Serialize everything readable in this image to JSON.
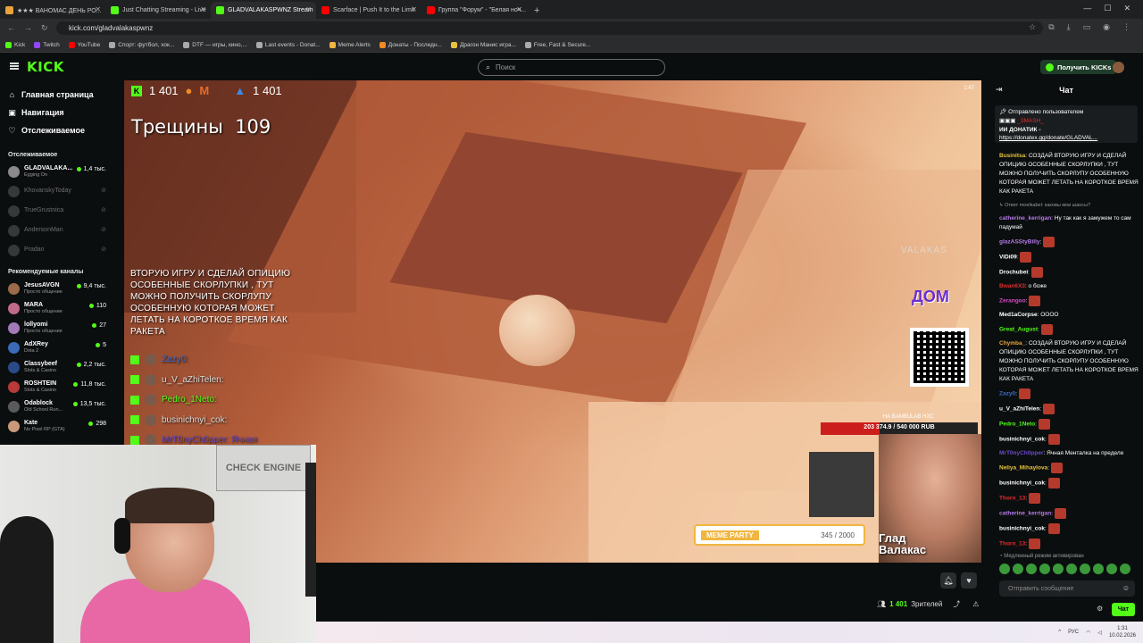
{
  "browser": {
    "tabs": [
      {
        "title": "★★★ ВАНОМАС ДЕНЬ РО...",
        "color": "#e8a33c"
      },
      {
        "title": "Just Chatting Streaming - Live",
        "color": "#53fc18"
      },
      {
        "title": "GLADVALAKASPWNZ Stream",
        "color": "#53fc18",
        "active": true
      },
      {
        "title": "Scarface | Push It to the Limit",
        "color": "#ff0000"
      },
      {
        "title": "Группа \"Форум\" - \"Белая ноч...",
        "color": "#ff0000"
      }
    ],
    "url": "kick.com/gladvalakaspwnz",
    "bookmarks": [
      {
        "label": "Kick",
        "color": "#53fc18"
      },
      {
        "label": "Twitch",
        "color": "#9146ff"
      },
      {
        "label": "YouTube",
        "color": "#ff0000"
      },
      {
        "label": "Спорт: футбол, хок...",
        "color": "#aaaaaa"
      },
      {
        "label": "DTF — игры, кино,...",
        "color": "#aaaaaa"
      },
      {
        "label": "Last events - Donat...",
        "color": "#aaaaaa"
      },
      {
        "label": "Meme Alerts",
        "color": "#f0b640"
      },
      {
        "label": "Донаты - Последн...",
        "color": "#f08a24"
      },
      {
        "label": "Драгон Манис игра...",
        "color": "#e8c33c"
      },
      {
        "label": "Free, Fast & Secure...",
        "color": "#aaaaaa"
      }
    ]
  },
  "header": {
    "logo": "KICK",
    "search_placeholder": "Поиск",
    "get_kicks": "Получить KICKs"
  },
  "sidebar": {
    "nav": [
      {
        "label": "Главная страница",
        "icon": "home-icon",
        "glyph": "⌂"
      },
      {
        "label": "Навигация",
        "icon": "browse-icon",
        "glyph": "▣"
      },
      {
        "label": "Отслеживаемое",
        "icon": "heart-icon",
        "glyph": "♡"
      }
    ],
    "followed_title": "Отслеживаемое",
    "followed": [
      {
        "name": "GLADVALAKA...",
        "sub": "Egging On",
        "viewers": "1,4 тыс.",
        "live": true,
        "color": "#8a8a8a"
      },
      {
        "name": "KhovanskyToday",
        "live": false,
        "color": "#777777"
      },
      {
        "name": "TrueGrustnica",
        "live": false,
        "color": "#777777"
      },
      {
        "name": "AndersonMan",
        "live": false,
        "color": "#777777"
      },
      {
        "name": "Pradan",
        "live": false,
        "color": "#777777"
      }
    ],
    "recommended_title": "Рекомендуемые каналы",
    "recommended": [
      {
        "name": "JesusAVGN",
        "sub": "Просто общение",
        "viewers": "9,4 тыс.",
        "color": "#9a6a4a"
      },
      {
        "name": "MARA",
        "sub": "Просто общение",
        "viewers": "110",
        "color": "#c06a8a"
      },
      {
        "name": "lollyomi",
        "sub": "Просто общение",
        "viewers": "27",
        "color": "#a37ab8"
      },
      {
        "name": "AdXRey",
        "sub": "Dota 2",
        "viewers": "5",
        "color": "#3a6ab8"
      },
      {
        "name": "Classybeef",
        "sub": "Slots & Casino",
        "viewers": "2,2 тыс.",
        "color": "#2a4a8a"
      },
      {
        "name": "ROSHTEIN",
        "sub": "Slots & Casino",
        "viewers": "11,8 тыс.",
        "color": "#b83a3a"
      },
      {
        "name": "Odablock",
        "sub": "Old School Run...",
        "viewers": "13,5 тыс.",
        "color": "#5a5a5a"
      },
      {
        "name": "Kate",
        "sub": "No Pixel RP (GTA)",
        "viewers": "298",
        "color": "#c89a7a"
      }
    ]
  },
  "video": {
    "top_count_left": "1 401",
    "top_count_right": "1 401",
    "cracks_label": "Трещины",
    "cracks_value": "109",
    "overlay_message": "ВТОРУЮ ИГРУ И СДЕЛАЙ ОПИЦИЮ ОСОБЕННЫЕ СКОРЛУПКИ , ТУТ МОЖНО ПОЛУЧИТЬ СКОРЛУПУ ОСОБЕННУЮ КОТОРАЯ МОЖЕТ ЛЕТАТЬ НА КОРОТКОЕ ВРЕМЯ КАК РАКЕТА",
    "overlay_chat": [
      {
        "user": "Zazy0:",
        "color": "#3a6ac8"
      },
      {
        "user": "u_V_aZhiTelen:",
        "color": "#dddddd"
      },
      {
        "user": "Pedro_1Neto:",
        "color": "#53fc18"
      },
      {
        "user": "businichnyi_cok:",
        "color": "#dddddd"
      },
      {
        "user": "MrT0nyCh0pper: Ячная",
        "color": "#6a4ac8"
      }
    ],
    "watermark": "VALAKAS",
    "dom_logo": "ДОМ",
    "goal_title": "НА BAMBULAB H2C",
    "goal_text": "203 374.9 / 540 000 RUB",
    "goal_fraction": 0.377,
    "meme_label": "MEME PARTY",
    "meme_count": "345 / 2000",
    "streamer_name_1": "Глад",
    "streamer_name_2": "Валакас",
    "corner": "1:47"
  },
  "webcam": {
    "poster_text": "CHECK ENGINE"
  },
  "below_video": {
    "viewers": "1 401",
    "viewers_label": "Зрителей"
  },
  "chat": {
    "title": "Чат",
    "pinned_by": "Отправлено пользователем",
    "pinned_user": "_3MASH_",
    "pinned_text": "ИИ ДОНАТИК -",
    "pinned_link": "https://donatex.gg/donate/GLADVAL...",
    "messages": [
      {
        "user": "Businitsa",
        "color": "#e8c33c",
        "text": ": СОЗДАЙ ВТОРУЮ ИГРУ И СДЕЛАЙ ОПИЦИЮ ОСОБЕННЫЕ СКОРЛУПКИ , ТУТ МОЖНО ПОЛУЧИТЬ СКОРЛУПУ ОСОБЕННУЮ КОТОРАЯ МОЖЕТ ЛЕТАТЬ НА КОРОТКОЕ ВРЕМЯ КАК РАКЕТА"
      },
      {
        "user": "",
        "color": "#9a9a9a",
        "text": "↳ Ответ moelkabel: каковы мои шансы?",
        "sys": true
      },
      {
        "user": "catherine_kerrigan",
        "color": "#b57ae8",
        "text": ": Ну так как я замужем то сам падумай"
      },
      {
        "user": "glazASStyBilly",
        "color": "#b57ae8",
        "text": ":",
        "emo": true
      },
      {
        "user": "ViDi09",
        "color": "#ffffff",
        "text": ":",
        "emo": true
      },
      {
        "user": "Drochubei",
        "color": "#ffffff",
        "text": ":",
        "emo": true
      },
      {
        "user": "Bwan6X3",
        "color": "#e02d2d",
        "text": ": о боже"
      },
      {
        "user": "Zerangoo",
        "color": "#d84ac8",
        "text": ":",
        "emo": true
      },
      {
        "user": "Med1aCorpse",
        "color": "#ffffff",
        "text": ": ОООО"
      },
      {
        "user": "Great_August",
        "color": "#53fc18",
        "text": ":",
        "emo": true
      },
      {
        "user": "Chymba_",
        "color": "#e8a33c",
        "text": ": СОЗДАЙ ВТОРУЮ ИГРУ И СДЕЛАЙ ОПИЦИЮ ОСОБЕННЫЕ СКОРЛУПКИ , ТУТ МОЖНО ПОЛУЧИТЬ СКОРЛУПУ ОСОБЕННУЮ КОТОРАЯ МОЖЕТ ЛЕТАТЬ НА КОРОТКОЕ ВРЕМЯ КАК РАКЕТА"
      },
      {
        "user": "Zazy0",
        "color": "#3a6ac8",
        "text": ":",
        "emo": true
      },
      {
        "user": "u_V_aZhiTelen",
        "color": "#ffffff",
        "text": ":",
        "emo": true
      },
      {
        "user": "Pedro_1Neto",
        "color": "#53fc18",
        "text": ":",
        "emo": true
      },
      {
        "user": "businichnyi_cok",
        "color": "#ffffff",
        "text": ":",
        "emo": true
      },
      {
        "user": "MrT0nyCh0pper",
        "color": "#6a4ac8",
        "text": ": Ячная Менталка на пределе"
      },
      {
        "user": "Neliya_Mihaylova",
        "color": "#e8c33c",
        "text": ":",
        "emo": true
      },
      {
        "user": "businichnyi_cok",
        "color": "#ffffff",
        "text": ":",
        "emo": true
      },
      {
        "user": "Thorn_13",
        "color": "#e02d2d",
        "text": ":",
        "emo": true
      },
      {
        "user": "catherine_kerrigan",
        "color": "#b57ae8",
        "text": ":",
        "emo": true
      },
      {
        "user": "businichnyi_cok",
        "color": "#ffffff",
        "text": ":",
        "emo": true
      },
      {
        "user": "Thorn_13",
        "color": "#e02d2d",
        "text": ":",
        "emo": true
      }
    ],
    "slow_mode": "Медленный режим активирован",
    "input_placeholder": "Отправить сообщение",
    "send_label": "Чат"
  },
  "taskbar": {
    "lang": "РУС",
    "time": "1:31",
    "date": "10.02.2026"
  }
}
